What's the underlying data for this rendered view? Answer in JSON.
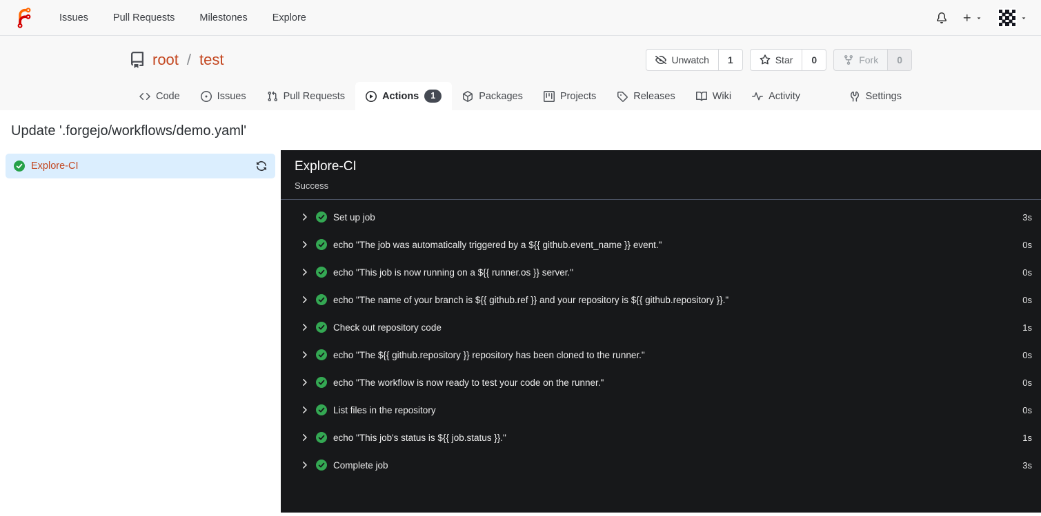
{
  "navbar": {
    "links": [
      {
        "label": "Issues"
      },
      {
        "label": "Pull Requests"
      },
      {
        "label": "Milestones"
      },
      {
        "label": "Explore"
      }
    ]
  },
  "repo": {
    "owner": "root",
    "separator": "/",
    "name": "test",
    "actions": {
      "unwatch": {
        "label": "Unwatch",
        "count": "1"
      },
      "star": {
        "label": "Star",
        "count": "0"
      },
      "fork": {
        "label": "Fork",
        "count": "0"
      }
    }
  },
  "tabs": [
    {
      "label": "Code"
    },
    {
      "label": "Issues"
    },
    {
      "label": "Pull Requests"
    },
    {
      "label": "Actions",
      "badge": "1"
    },
    {
      "label": "Packages"
    },
    {
      "label": "Projects"
    },
    {
      "label": "Releases"
    },
    {
      "label": "Wiki"
    },
    {
      "label": "Activity"
    },
    {
      "label": "Settings"
    }
  ],
  "page": {
    "title": "Update '.forgejo/workflows/demo.yaml'"
  },
  "sidebar": {
    "job": {
      "label": "Explore-CI",
      "status": "success"
    }
  },
  "panel": {
    "title": "Explore-CI",
    "status": "Success",
    "steps": [
      {
        "name": "Set up job",
        "duration": "3s"
      },
      {
        "name": "echo \"The job was automatically triggered by a ${{ github.event_name }} event.\"",
        "duration": "0s"
      },
      {
        "name": "echo \"This job is now running on a ${{ runner.os }} server.\"",
        "duration": "0s"
      },
      {
        "name": "echo \"The name of your branch is ${{ github.ref }} and your repository is ${{ github.repository }}.\"",
        "duration": "0s"
      },
      {
        "name": "Check out repository code",
        "duration": "1s"
      },
      {
        "name": "echo \"The ${{ github.repository }} repository has been cloned to the runner.\"",
        "duration": "0s"
      },
      {
        "name": "echo \"The workflow is now ready to test your code on the runner.\"",
        "duration": "0s"
      },
      {
        "name": "List files in the repository",
        "duration": "0s"
      },
      {
        "name": "echo \"This job's status is ${{ job.status }}.\"",
        "duration": "1s"
      },
      {
        "name": "Complete job",
        "duration": "3s"
      }
    ]
  },
  "colors": {
    "accent_link": "#c3461f",
    "success_green": "#2da44e",
    "panel_bg": "#17181a",
    "panel_divider": "#4e5566",
    "selected_job_bg": "#dbeefe",
    "badge_bg": "#454a53",
    "header_bg": "#f8f8f8",
    "logo_orange": "#ff6600",
    "logo_red": "#d40000"
  }
}
